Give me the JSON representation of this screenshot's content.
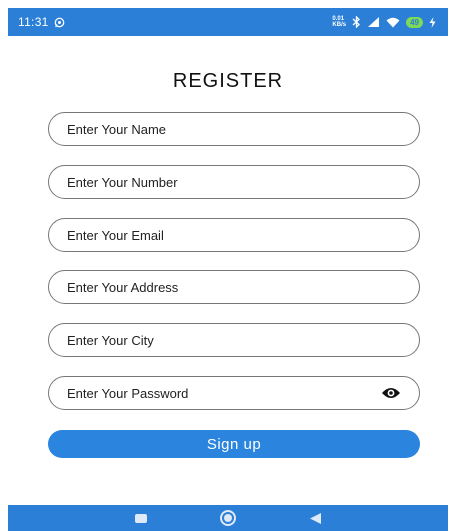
{
  "status_bar": {
    "time": "11:31",
    "speed_value": "0.01",
    "speed_unit": "KB/s",
    "battery": "49"
  },
  "form": {
    "title": "REGISTER",
    "fields": {
      "name": {
        "placeholder": "Enter Your Name",
        "value": ""
      },
      "number": {
        "placeholder": "Enter Your Number",
        "value": ""
      },
      "email": {
        "placeholder": "Enter Your Email",
        "value": ""
      },
      "address": {
        "placeholder": "Enter Your Address",
        "value": ""
      },
      "city": {
        "placeholder": "Enter Your City",
        "value": ""
      },
      "password": {
        "placeholder": "Enter Your Password",
        "value": ""
      }
    },
    "signup_label": "Sign up"
  },
  "icons": {
    "status": [
      "whatsapp-icon",
      "bluetooth-icon",
      "signal-icon",
      "wifi-icon",
      "battery-icon",
      "charging-icon"
    ],
    "password_toggle": "eye-icon",
    "navigation": [
      "recent-apps-icon",
      "home-icon",
      "back-icon"
    ]
  },
  "colors": {
    "status_bar": "#2b7fd6",
    "button": "#2b85de",
    "battery": "#7ed957"
  }
}
